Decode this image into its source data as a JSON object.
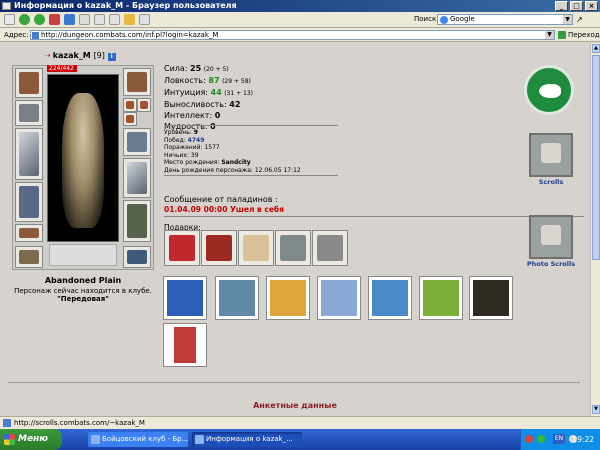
{
  "window": {
    "title": "Информация о kazak_M - Браузер пользователя",
    "buttons": [
      "_",
      "□",
      "×"
    ]
  },
  "toolbar": {
    "search_label": "Поиск:",
    "search_value": "Google",
    "go_arrow": "↗"
  },
  "address": {
    "label": "Адрес:",
    "url": "http://dungeon.combats.com/inf.pl?login=kazak_M",
    "go_label": "Переход"
  },
  "character": {
    "name": "kazak_M",
    "level": "[9]",
    "badge": "i",
    "hp": "224/442",
    "location_title": "Abandoned Plain",
    "location_line1": "Персонаж сейчас находится в клубе.",
    "location_room": "\"Передовая\""
  },
  "stats": [
    {
      "label": "Сила:",
      "value": "25",
      "bonus": "(20 + 5)",
      "green": false
    },
    {
      "label": "Ловкость:",
      "value": "87",
      "bonus": "(29 + 58)",
      "green": true
    },
    {
      "label": "Интуиция:",
      "value": "44",
      "bonus": "(31 + 13)",
      "green": true
    },
    {
      "label": "Выносливость:",
      "value": "42",
      "bonus": "",
      "green": false
    },
    {
      "label": "Интеллект:",
      "value": "0",
      "bonus": "",
      "green": false
    },
    {
      "label": "Мудрость:",
      "value": "0",
      "bonus": "",
      "green": false
    }
  ],
  "info": [
    {
      "label": "Уровень:",
      "value": "9"
    },
    {
      "label": "Побед:",
      "value": "4749"
    },
    {
      "label": "Поражений:",
      "value": "1577"
    },
    {
      "label": "Ничьих:",
      "value": "39"
    },
    {
      "label": "Место рождения:",
      "value": "Sandcity"
    },
    {
      "label": "День рождения персонажа:",
      "value": "12.06.05 17:12"
    }
  ],
  "paladin": {
    "title": "Сообщение от паладинов :",
    "message": "01.04.09 00:00 Ушел в себя"
  },
  "gifts_label": "Подарки:",
  "scrolls": [
    {
      "label": "Scrolls"
    },
    {
      "label": "Photo Scrolls"
    }
  ],
  "anketa_label": "Анкетные данные",
  "statusbar_text": "http://scrolls.combats.com/~kazak_M",
  "taskbar": {
    "start": "Меню",
    "tasks": [
      "Бойцовский клуб - Бр...",
      "Информация о kazak_..."
    ],
    "lang": "EN",
    "clock": "19:22"
  },
  "colors": {
    "accent_title": "#0a246a",
    "stat_green": "#1f8b1f",
    "paladin_red": "#cc0000",
    "anketa": "#8b1f1f",
    "clan_green": "#1f8b3f"
  }
}
